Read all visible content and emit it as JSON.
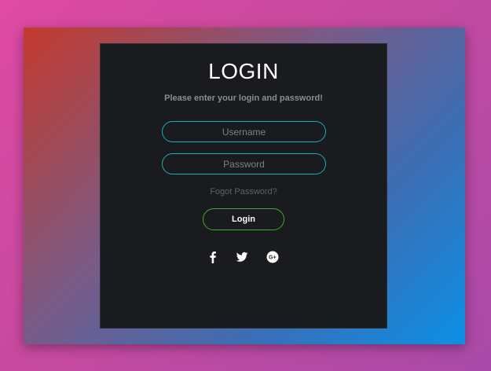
{
  "login": {
    "title": "LOGIN",
    "subtitle": "Please enter your login and password!",
    "username_placeholder": "Username",
    "password_placeholder": "Password",
    "forgot_label": "Fogot Password?",
    "submit_label": "Login"
  },
  "social": {
    "icons": [
      "facebook-icon",
      "twitter-icon",
      "google-plus-icon"
    ]
  },
  "colors": {
    "card_background": "#191b1e",
    "input_border": "#1ab2b2",
    "button_border": "#3dab2e"
  }
}
